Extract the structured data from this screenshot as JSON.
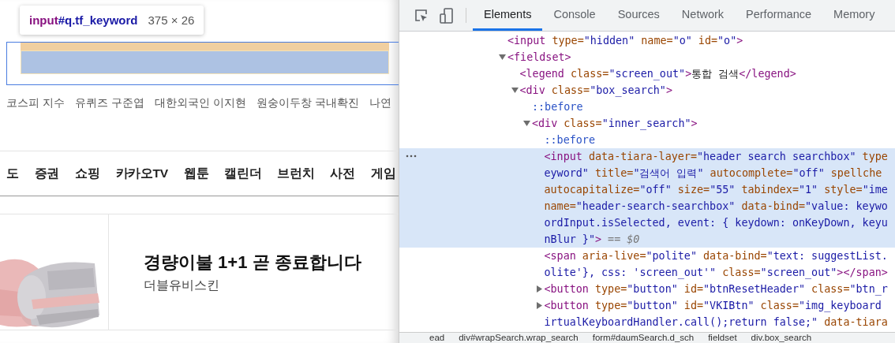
{
  "page": {
    "inspect_tooltip": {
      "selector_tag": "input",
      "selector_rest": "#q.tf_keyword",
      "size": "375 × 26"
    },
    "trending": [
      "코스피 지수",
      "유퀴즈 구준엽",
      "대한외국인 이지현",
      "원숭이두창 국내확진",
      "나연"
    ],
    "nav": [
      "도",
      "증권",
      "쇼핑",
      "카카오TV",
      "웹툰",
      "캘린더",
      "브런치",
      "사전",
      "게임"
    ],
    "ad": {
      "kind": "picture",
      "title": "경량이불 1+1 곧 종료합니다",
      "brand": "더블유비스킨"
    }
  },
  "devtools": {
    "tabs": [
      {
        "label": "Elements",
        "selected": true
      },
      {
        "label": "Console",
        "selected": false
      },
      {
        "label": "Sources",
        "selected": false
      },
      {
        "label": "Network",
        "selected": false
      },
      {
        "label": "Performance",
        "selected": false
      },
      {
        "label": "Memory",
        "selected": false
      }
    ],
    "tree": [
      {
        "selected": false,
        "lines": [
          [
            {
              "kind": "tag",
              "text": "<input"
            },
            {
              "kind": "attr",
              "text": " type="
            },
            {
              "kind": "value",
              "text": "\"hidden\""
            },
            {
              "kind": "attr",
              "text": " name="
            },
            {
              "kind": "value",
              "text": "\"o\""
            },
            {
              "kind": "attr",
              "text": " id="
            },
            {
              "kind": "value",
              "text": "\"o\""
            },
            {
              "kind": "tag",
              "text": ">"
            }
          ]
        ]
      },
      {
        "selected": false,
        "expanded": true,
        "lines": [
          [
            {
              "kind": "tag",
              "text": "<fieldset>"
            }
          ]
        ],
        "children": [
          {
            "selected": false,
            "lines": [
              [
                {
                  "kind": "tag",
                  "text": "<legend"
                },
                {
                  "kind": "attr",
                  "text": " class="
                },
                {
                  "kind": "value",
                  "text": "\"screen_out\""
                },
                {
                  "kind": "tag",
                  "text": ">"
                },
                {
                  "kind": "text",
                  "text": "통합 검색"
                },
                {
                  "kind": "tag",
                  "text": "</legend>"
                }
              ]
            ]
          },
          {
            "selected": false,
            "expanded": true,
            "lines": [
              [
                {
                  "kind": "tag",
                  "text": "<div"
                },
                {
                  "kind": "attr",
                  "text": " class="
                },
                {
                  "kind": "value",
                  "text": "\"box_search\""
                },
                {
                  "kind": "tag",
                  "text": ">"
                }
              ]
            ],
            "children": [
              {
                "selected": false,
                "lines": [
                  [
                    {
                      "kind": "pseudo",
                      "text": "::before"
                    }
                  ]
                ]
              },
              {
                "selected": false,
                "expanded": true,
                "lines": [
                  [
                    {
                      "kind": "tag",
                      "text": "<div"
                    },
                    {
                      "kind": "attr",
                      "text": " class="
                    },
                    {
                      "kind": "value",
                      "text": "\"inner_search\""
                    },
                    {
                      "kind": "tag",
                      "text": ">"
                    }
                  ]
                ],
                "children": [
                  {
                    "selected": false,
                    "lines": [
                      [
                        {
                          "kind": "pseudo",
                          "text": "::before"
                        }
                      ]
                    ]
                  },
                  {
                    "selected": true,
                    "lines": [
                      [
                        {
                          "kind": "tag",
                          "text": "<input"
                        },
                        {
                          "kind": "attr",
                          "text": " data-tiara-layer="
                        },
                        {
                          "kind": "value",
                          "text": "\"header search searchbox\""
                        },
                        {
                          "kind": "attr",
                          "text": " type"
                        }
                      ],
                      [
                        {
                          "kind": "value",
                          "text": "eyword\""
                        },
                        {
                          "kind": "attr",
                          "text": " title="
                        },
                        {
                          "kind": "value",
                          "text": "\"검색어 입력\""
                        },
                        {
                          "kind": "attr",
                          "text": " autocomplete="
                        },
                        {
                          "kind": "value",
                          "text": "\"off\""
                        },
                        {
                          "kind": "attr",
                          "text": " spellche"
                        }
                      ],
                      [
                        {
                          "kind": "attr",
                          "text": "autocapitalize="
                        },
                        {
                          "kind": "value",
                          "text": "\"off\""
                        },
                        {
                          "kind": "attr",
                          "text": " size="
                        },
                        {
                          "kind": "value",
                          "text": "\"55\""
                        },
                        {
                          "kind": "attr",
                          "text": " tabindex="
                        },
                        {
                          "kind": "value",
                          "text": "\"1\""
                        },
                        {
                          "kind": "attr",
                          "text": " style="
                        },
                        {
                          "kind": "value",
                          "text": "\"ime"
                        }
                      ],
                      [
                        {
                          "kind": "attr",
                          "text": "name="
                        },
                        {
                          "kind": "value",
                          "text": "\"header-search-searchbox\""
                        },
                        {
                          "kind": "attr",
                          "text": " data-bind="
                        },
                        {
                          "kind": "value",
                          "text": "\"value: keywo"
                        }
                      ],
                      [
                        {
                          "kind": "value",
                          "text": "ordInput.isSelected, event: { keydown: onKeyDown, keyu"
                        }
                      ],
                      [
                        {
                          "kind": "value",
                          "text": "nBlur }\""
                        },
                        {
                          "kind": "tag",
                          "text": ">"
                        },
                        {
                          "kind": "comment",
                          "text": " == $0"
                        }
                      ]
                    ]
                  },
                  {
                    "selected": false,
                    "lines": [
                      [
                        {
                          "kind": "tag",
                          "text": "<span"
                        },
                        {
                          "kind": "attr",
                          "text": " aria-live="
                        },
                        {
                          "kind": "value",
                          "text": "\"polite\""
                        },
                        {
                          "kind": "attr",
                          "text": " data-bind="
                        },
                        {
                          "kind": "value",
                          "text": "\"text: suggestList."
                        }
                      ],
                      [
                        {
                          "kind": "value",
                          "text": "olite'}, css: 'screen_out'\""
                        },
                        {
                          "kind": "attr",
                          "text": " class="
                        },
                        {
                          "kind": "value",
                          "text": "\"screen_out\""
                        },
                        {
                          "kind": "tag",
                          "text": "></span>"
                        }
                      ]
                    ]
                  },
                  {
                    "selected": false,
                    "expanded": false,
                    "lines": [
                      [
                        {
                          "kind": "tag",
                          "text": "<button"
                        },
                        {
                          "kind": "attr",
                          "text": " type="
                        },
                        {
                          "kind": "value",
                          "text": "\"button\""
                        },
                        {
                          "kind": "attr",
                          "text": " id="
                        },
                        {
                          "kind": "value",
                          "text": "\"btnResetHeader\""
                        },
                        {
                          "kind": "attr",
                          "text": " class="
                        },
                        {
                          "kind": "value",
                          "text": "\"btn_r"
                        }
                      ]
                    ]
                  },
                  {
                    "selected": false,
                    "expanded": false,
                    "lines": [
                      [
                        {
                          "kind": "tag",
                          "text": "<button"
                        },
                        {
                          "kind": "attr",
                          "text": " type="
                        },
                        {
                          "kind": "value",
                          "text": "\"button\""
                        },
                        {
                          "kind": "attr",
                          "text": " id="
                        },
                        {
                          "kind": "value",
                          "text": "\"VKIBtn\""
                        },
                        {
                          "kind": "attr",
                          "text": " class="
                        },
                        {
                          "kind": "value",
                          "text": "\"img_keyboard"
                        }
                      ],
                      [
                        {
                          "kind": "value",
                          "text": "irtualKeyboardHandler.call();return false;\""
                        },
                        {
                          "kind": "attr",
                          "text": " data-tiara"
                        }
                      ]
                    ]
                  }
                ]
              }
            ]
          }
        ]
      }
    ],
    "breadcrumbs": [
      "ead",
      "div#wrapSearch.wrap_search",
      "form#daumSearch.d_sch",
      "fieldset",
      "div.box_search"
    ]
  }
}
